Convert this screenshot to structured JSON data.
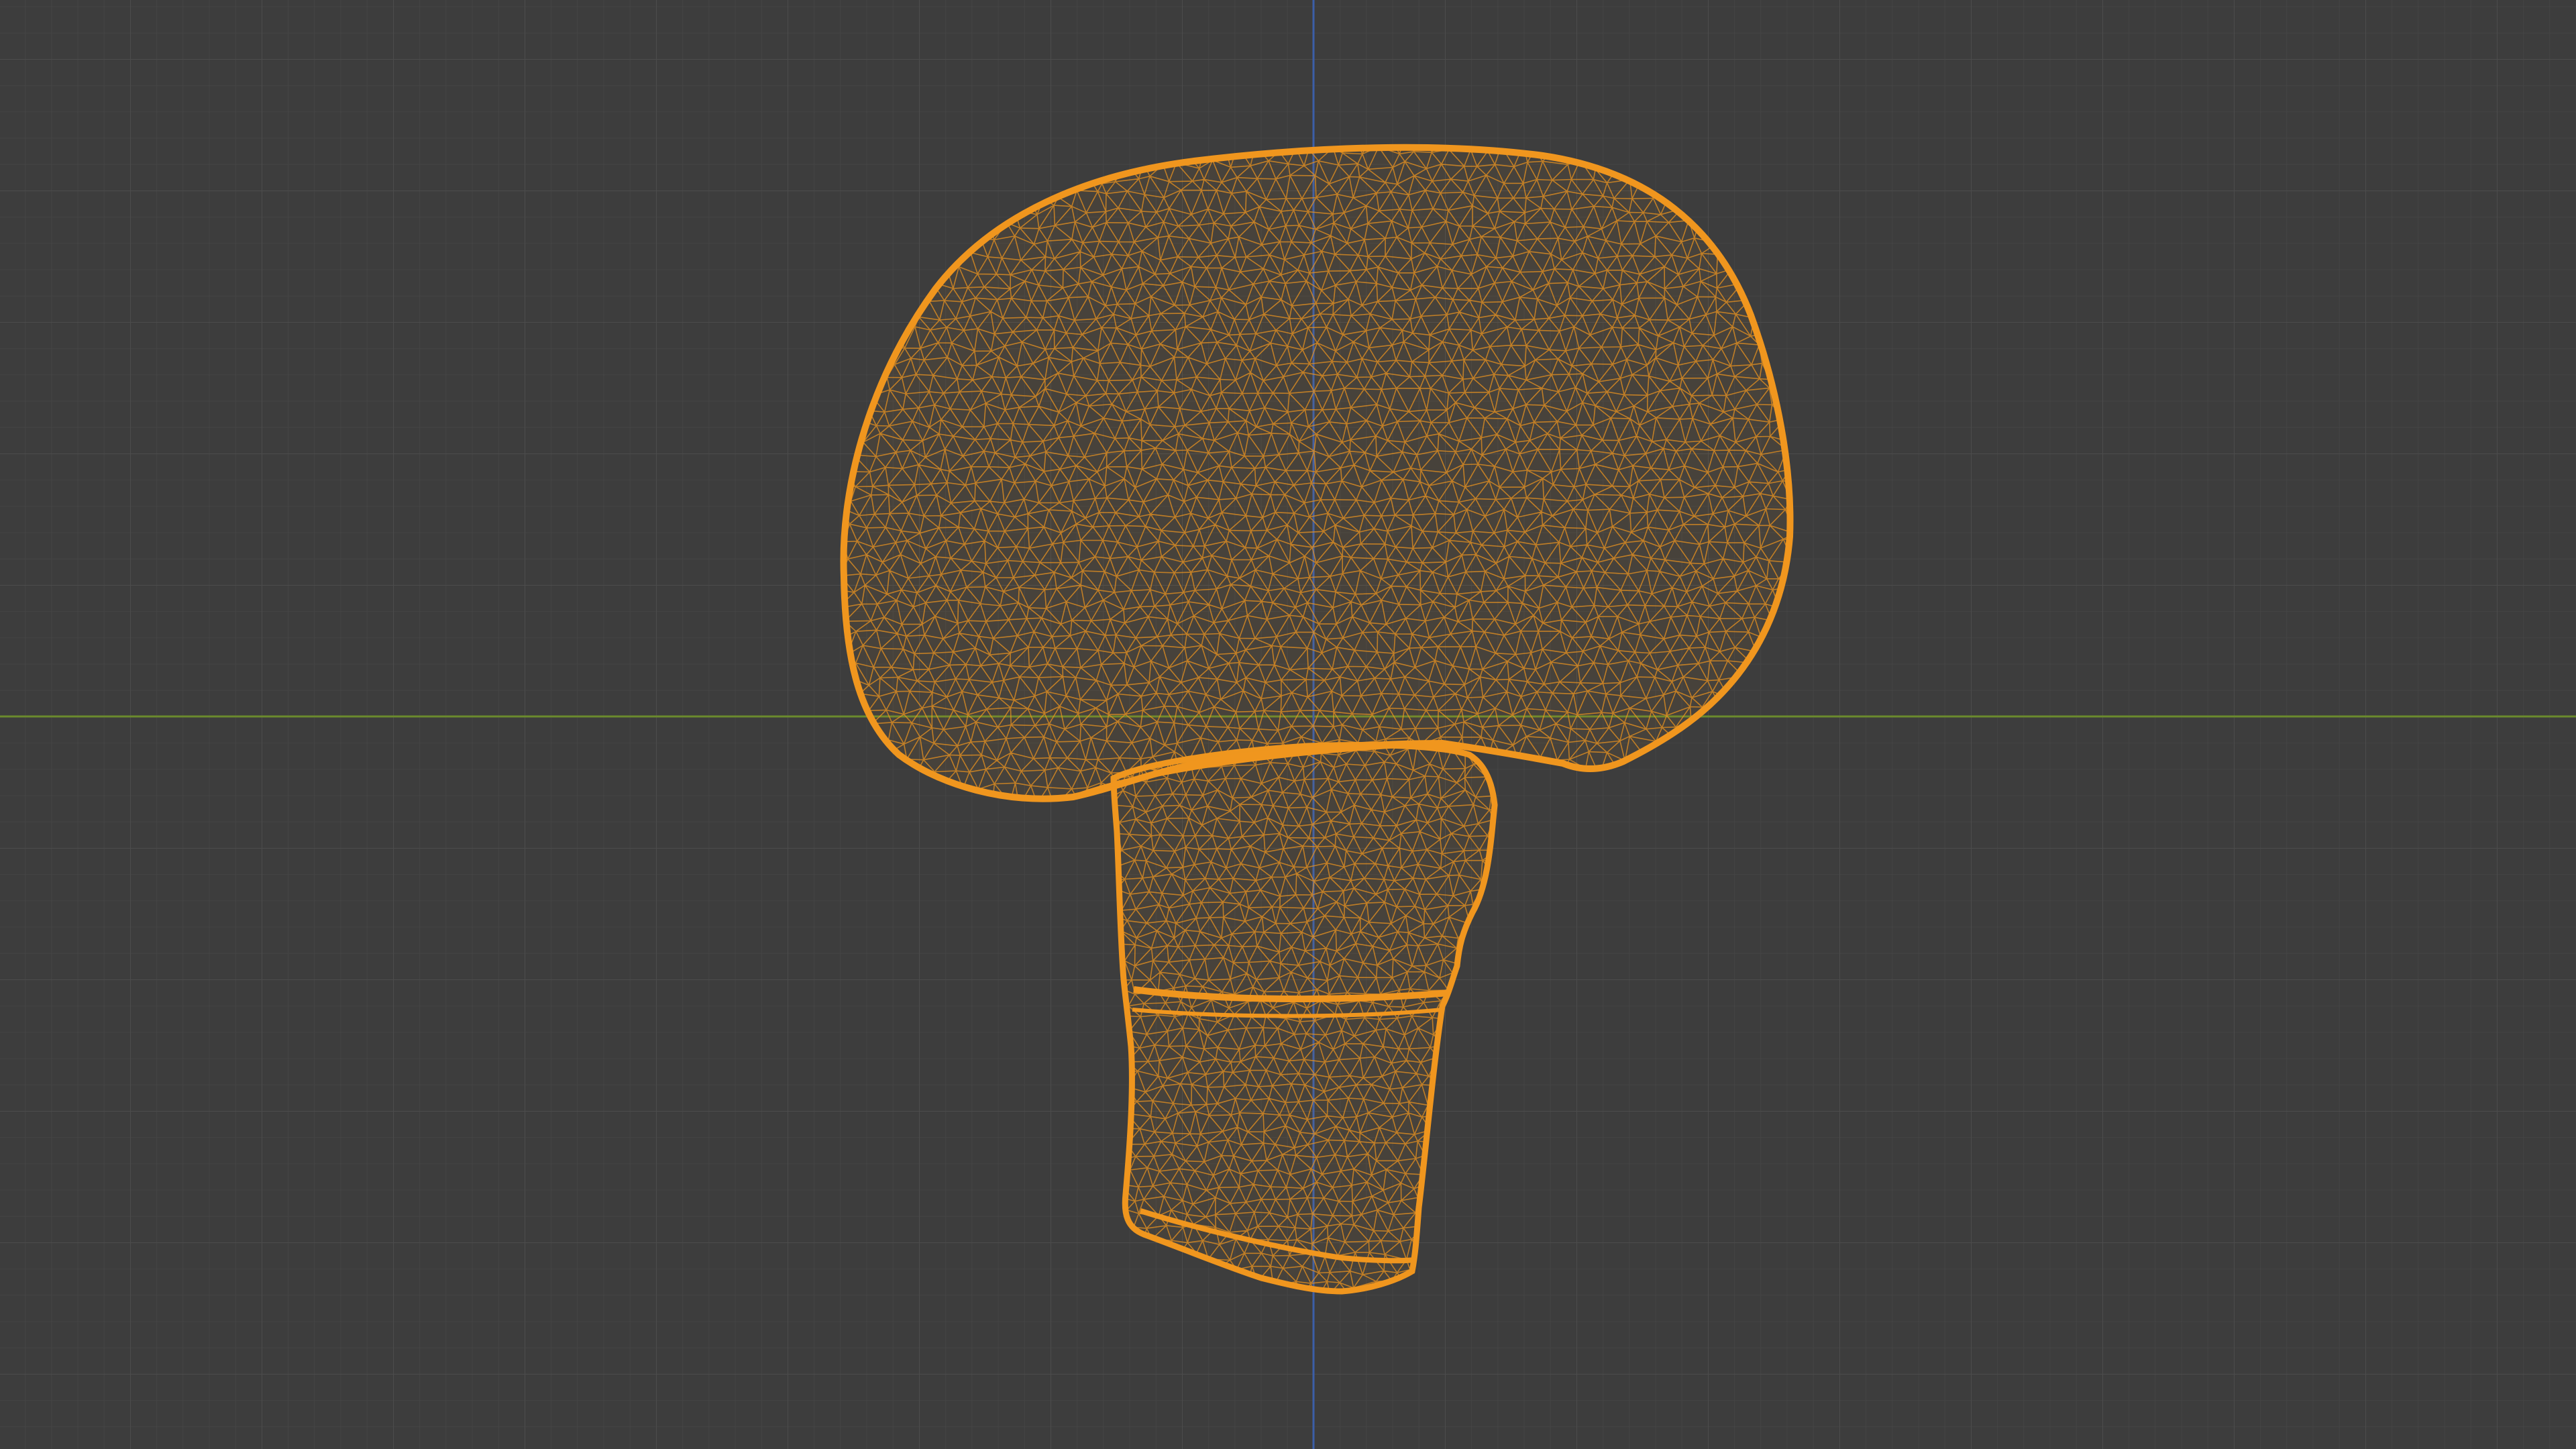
{
  "viewport": {
    "background_color": "#3d3d3d",
    "grid_minor_color": "#444444",
    "grid_major_color": "#4a4a4a",
    "axis_x_color": "#6b8a2d",
    "axis_z_color": "#3b5ea8",
    "shading_mode": "wireframe"
  },
  "object": {
    "name": "mushroom-mesh",
    "wire_color": "#f0961e",
    "selected": true
  }
}
